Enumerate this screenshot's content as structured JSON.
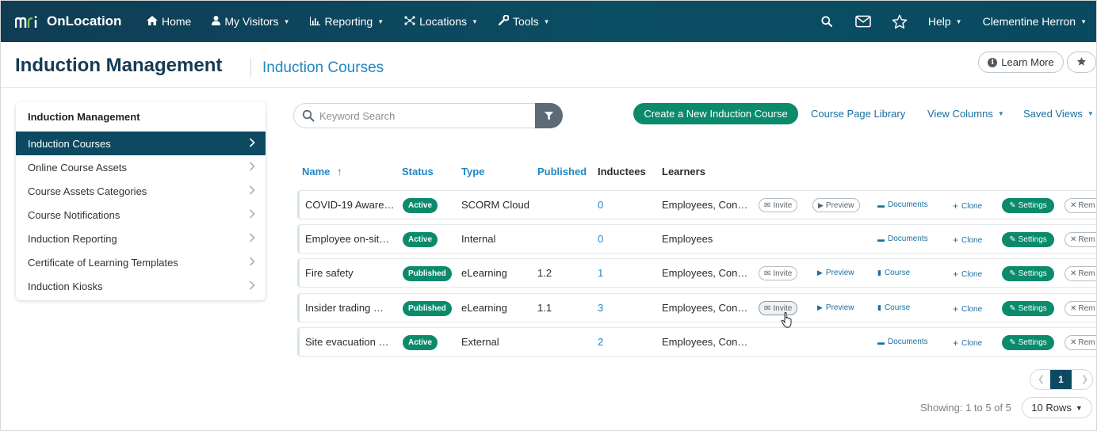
{
  "navbar": {
    "logo_text": "mri",
    "brand": "OnLocation",
    "items": [
      {
        "label": "Home",
        "icon": "home-icon",
        "caret": false
      },
      {
        "label": "My Visitors",
        "icon": "user-icon",
        "caret": true
      },
      {
        "label": "Reporting",
        "icon": "bar-chart-icon",
        "caret": true
      },
      {
        "label": "Locations",
        "icon": "network-icon",
        "caret": true
      },
      {
        "label": "Tools",
        "icon": "wrench-icon",
        "caret": true
      }
    ],
    "help_label": "Help",
    "user_name": "Clementine Herron",
    "icons": [
      "search-icon",
      "mail-icon",
      "star-icon"
    ]
  },
  "header": {
    "title": "Induction Management",
    "subtitle": "Induction Courses",
    "learn_more_label": "Learn More"
  },
  "sidebar": {
    "title": "Induction Management",
    "items": [
      {
        "label": "Induction Courses",
        "active": true
      },
      {
        "label": "Online Course Assets",
        "active": false
      },
      {
        "label": "Course Assets Categories",
        "active": false
      },
      {
        "label": "Course Notifications",
        "active": false
      },
      {
        "label": "Induction Reporting",
        "active": false
      },
      {
        "label": "Certificate of Learning Templates",
        "active": false
      },
      {
        "label": "Induction Kiosks",
        "active": false
      }
    ]
  },
  "toolbar": {
    "search_placeholder": "Keyword Search",
    "create_label": "Create a New Induction Course",
    "library_label": "Course Page Library",
    "view_columns_label": "View Columns",
    "saved_views_label": "Saved Views"
  },
  "table": {
    "columns": [
      "Name",
      "Status",
      "Type",
      "Published",
      "Inductees",
      "Learners"
    ],
    "sort_arrow": "↑",
    "rows": [
      {
        "name": "COVID-19 Aware…",
        "status": "Active",
        "type": "SCORM Cloud",
        "published": "",
        "inductees": "0",
        "learners": "Employees, Con…",
        "invite": "Invite",
        "preview": "Preview",
        "doc": "Documents",
        "doc_kind": "documents",
        "clone": "Clone",
        "settings": "Settings",
        "remove": "Rem"
      },
      {
        "name": "Employee on-sit…",
        "status": "Active",
        "type": "Internal",
        "published": "",
        "inductees": "0",
        "learners": "Employees",
        "invite": "",
        "preview": "",
        "doc": "Documents",
        "doc_kind": "documents",
        "clone": "Clone",
        "settings": "Settings",
        "remove": "Rem"
      },
      {
        "name": "Fire safety",
        "status": "Published",
        "type": "eLearning",
        "published": "1.2",
        "inductees": "1",
        "learners": "Employees, Con…",
        "invite": "Invite",
        "preview": "Preview",
        "doc": "Course",
        "doc_kind": "course",
        "clone": "Clone",
        "settings": "Settings",
        "remove": "Rem"
      },
      {
        "name": "Insider trading …",
        "status": "Published",
        "type": "eLearning",
        "published": "1.1",
        "inductees": "3",
        "learners": "Employees, Con…",
        "invite": "Invite",
        "preview": "Preview",
        "doc": "Course",
        "doc_kind": "course",
        "clone": "Clone",
        "settings": "Settings",
        "remove": "Rem"
      },
      {
        "name": "Site evacuation …",
        "status": "Active",
        "type": "External",
        "published": "",
        "inductees": "2",
        "learners": "Employees, Con…",
        "invite": "",
        "preview": "",
        "doc": "Documents",
        "doc_kind": "documents",
        "clone": "Clone",
        "settings": "Settings",
        "remove": "Rem"
      }
    ]
  },
  "pagination": {
    "current_page": "1",
    "showing_text": "Showing: 1 to 5 of 5",
    "rows_label": "10 Rows"
  },
  "colors": {
    "navbar": "#0f3d55",
    "accent_green": "#0b8a6c",
    "link_blue": "#1f86c4",
    "active_nav": "#0d4a62"
  }
}
